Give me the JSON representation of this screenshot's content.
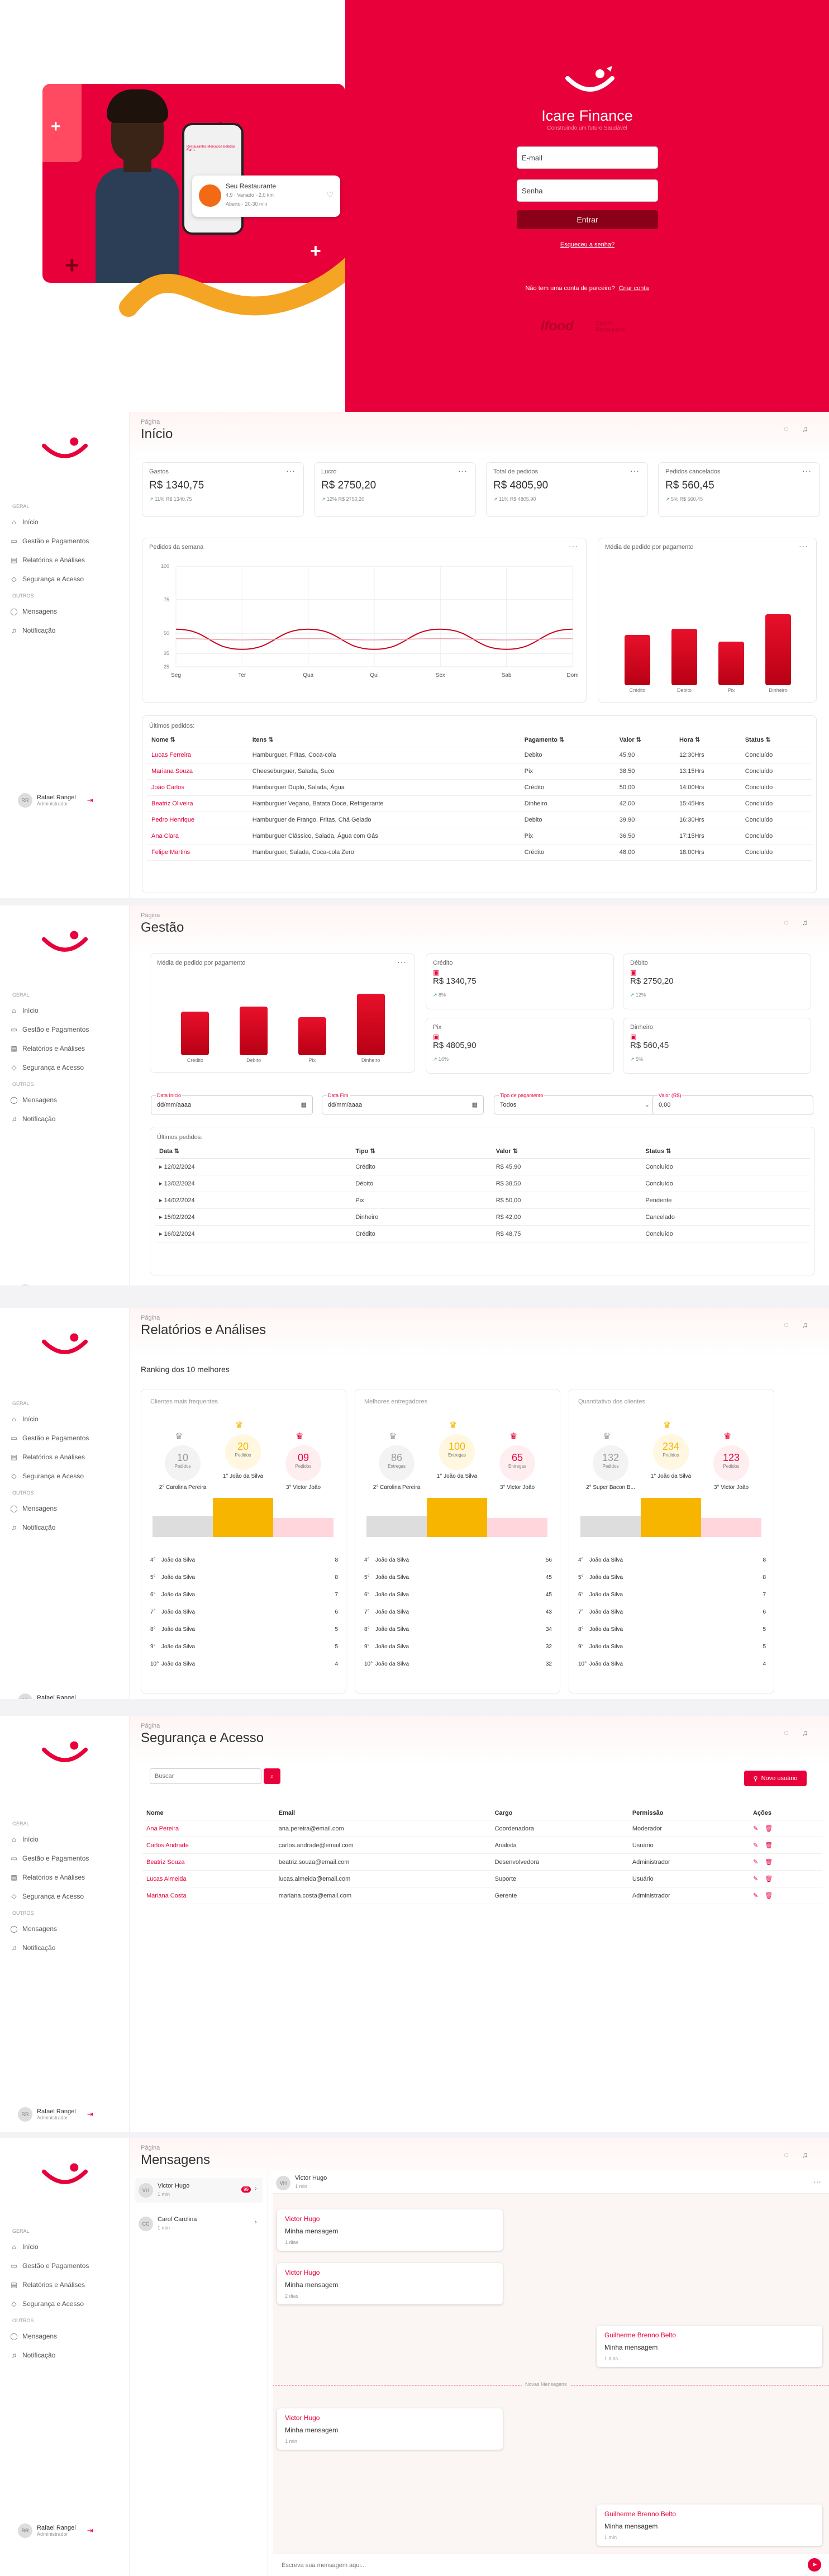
{
  "login": {
    "brand": "Icare Finance",
    "tagline": "Construindo um futuro Saudável",
    "email_placeholder": "E-mail",
    "password_placeholder": "Senha",
    "submit": "Entrar",
    "forgot": "Esqueceu a senha?",
    "partner_text": "Não tem uma conta de parceiro?",
    "partner_link": "Criar conta",
    "footer_logo": "ifood",
    "footer_logo2": "Credits Restaurante",
    "phone": {
      "name": "Seu Restaurante",
      "meta": "4,9 · Variado · 2,0 km",
      "time": "Aberto · 20-30 min",
      "tabs": "Restaurantes  Mercados  Bebidas  Farm."
    }
  },
  "sidebar": {
    "section1": "GERAL",
    "section2": "OUTROS",
    "items": [
      "Início",
      "Gestão e Pagamentos",
      "Relatórios e Análises",
      "Segurança e Acesso"
    ],
    "items2": [
      "Mensagens",
      "Notificação"
    ],
    "user_name": "Rafael Rangel",
    "user_role": "Administrador",
    "avatar": "RR"
  },
  "crumb": "Página",
  "inicio": {
    "title": "Início",
    "cards": [
      {
        "label": "Gastos",
        "value": "R$ 1340,75",
        "sub": "11%",
        "sub2": "R$ 1340,75"
      },
      {
        "label": "Lucro",
        "value": "R$ 2750,20",
        "sub": "12%",
        "sub2": "R$ 2750,20"
      },
      {
        "label": "Total de pedidos",
        "value": "R$ 4805,90",
        "sub": "11%",
        "sub2": "R$ 4805,90"
      },
      {
        "label": "Pedidos cancelados",
        "value": "R$ 560,45",
        "sub": "5%",
        "sub2": "R$ 560,45"
      }
    ],
    "line_title": "Pedidos da semana",
    "bar_title": "Média de pedido por pagamento",
    "recent_title": "Últimos pedidos:",
    "cols": [
      "Nome",
      "Itens",
      "Pagamento",
      "Valor",
      "Hora",
      "Status"
    ],
    "rows": [
      [
        "Lucas Ferreira",
        "Hamburguer, Fritas, Coca-cola",
        "Debito",
        "45,90",
        "12:30Hrs",
        "Concluído"
      ],
      [
        "Mariana Souza",
        "Cheeseburguer, Salada, Suco",
        "Pix",
        "38,50",
        "13:15Hrs",
        "Concluído"
      ],
      [
        "João Carlos",
        "Hamburguer Duplo, Salada, Água",
        "Crédito",
        "50,00",
        "14:00Hrs",
        "Concluído"
      ],
      [
        "Beatriz Oliveira",
        "Hamburguer Vegano, Batata Doce, Refrigerante",
        "Dinheiro",
        "42,00",
        "15:45Hrs",
        "Concluído"
      ],
      [
        "Pedro Henrique",
        "Hamburguer de Frango, Fritas, Chá Gelado",
        "Debito",
        "39,90",
        "16:30Hrs",
        "Concluído"
      ],
      [
        "Ana Clara",
        "Hamburguer Clássico, Salada, Água com Gás",
        "Pix",
        "36,50",
        "17:15Hrs",
        "Concluído"
      ],
      [
        "Felipe Martins",
        "Hamburguer, Salada, Coca-cola Zero",
        "Crédito",
        "48,00",
        "18:00Hrs",
        "Concluído"
      ]
    ]
  },
  "gestao": {
    "title": "Gestão",
    "bar_title": "Média de pedido por pagamento",
    "cards": [
      {
        "label": "Crédito",
        "value": "R$ 1340,75",
        "sub": "8%"
      },
      {
        "label": "Débito",
        "value": "R$ 2750,20",
        "sub": "12%"
      },
      {
        "label": "Pix",
        "value": "R$ 4805,90",
        "sub": "16%"
      },
      {
        "label": "Dinheiro",
        "value": "R$ 560,45",
        "sub": "5%"
      }
    ],
    "filters": [
      {
        "label": "Data Início",
        "value": "dd/mm/aaaa"
      },
      {
        "label": "Data Fim",
        "value": "dd/mm/aaaa"
      },
      {
        "label": "Tipo de pagamento",
        "value": "Todos"
      },
      {
        "label": "Valor (R$)",
        "value": "0,00"
      }
    ],
    "recent_title": "Últimos pedidos:",
    "cols": [
      "Data",
      "Tipo",
      "Valor",
      "Status"
    ],
    "rows": [
      [
        "12/02/2024",
        "Crédito",
        "R$ 45,90",
        "Concluído"
      ],
      [
        "13/02/2024",
        "Débito",
        "R$ 38,50",
        "Concluído"
      ],
      [
        "14/02/2024",
        "Pix",
        "R$ 50,00",
        "Pendente"
      ],
      [
        "15/02/2024",
        "Dinheiro",
        "R$ 42,00",
        "Cancelado"
      ],
      [
        "16/02/2024",
        "Crédito",
        "R$ 48,75",
        "Concluído"
      ]
    ]
  },
  "relatorios": {
    "title": "Relatórios e Análises",
    "subtitle": "Ranking dos 10 melhores",
    "panels": [
      {
        "title": "Clientes mais frequentes",
        "unit": "Pedidos",
        "top": [
          {
            "n": "10",
            "name": "2° Carolina Pereira"
          },
          {
            "n": "20",
            "name": "1° João da Silva"
          },
          {
            "n": "09",
            "name": "3° Victor João"
          }
        ],
        "list": [
          [
            "4°",
            "João da Silva",
            "8"
          ],
          [
            "5°",
            "João da Silva",
            "8"
          ],
          [
            "6°",
            "João da Silva",
            "7"
          ],
          [
            "7°",
            "João da Silva",
            "6"
          ],
          [
            "8°",
            "João da Silva",
            "5"
          ],
          [
            "9°",
            "João da Silva",
            "5"
          ],
          [
            "10°",
            "João da Silva",
            "4"
          ]
        ]
      },
      {
        "title": "Melhores entregadores",
        "unit": "Entregas",
        "top": [
          {
            "n": "86",
            "name": "2° Carolina Pereira"
          },
          {
            "n": "100",
            "name": "1° João da Silva"
          },
          {
            "n": "65",
            "name": "3° Victor João"
          }
        ],
        "list": [
          [
            "4°",
            "João da Silva",
            "56"
          ],
          [
            "5°",
            "João da Silva",
            "45"
          ],
          [
            "6°",
            "João da Silva",
            "45"
          ],
          [
            "7°",
            "João da Silva",
            "43"
          ],
          [
            "8°",
            "João da Silva",
            "34"
          ],
          [
            "9°",
            "João da Silva",
            "32"
          ],
          [
            "10°",
            "João da Silva",
            "32"
          ]
        ]
      },
      {
        "title": "Quantitativo dos clientes",
        "unit": "Pedidos",
        "top": [
          {
            "n": "132",
            "name": "2° Super Bacon B..."
          },
          {
            "n": "234",
            "name": "1° João da Silva"
          },
          {
            "n": "123",
            "name": "3° Victor João"
          }
        ],
        "list": [
          [
            "4°",
            "João da Silva",
            "8"
          ],
          [
            "5°",
            "João da Silva",
            "8"
          ],
          [
            "6°",
            "João da Silva",
            "7"
          ],
          [
            "7°",
            "João da Silva",
            "6"
          ],
          [
            "8°",
            "João da Silva",
            "5"
          ],
          [
            "9°",
            "João da Silva",
            "5"
          ],
          [
            "10°",
            "João da Silva",
            "4"
          ]
        ]
      }
    ]
  },
  "seguranca": {
    "title": "Segurança e Acesso",
    "search_placeholder": "Buscar",
    "new_user": "Novo usuário",
    "cols": [
      "Nome",
      "Email",
      "Cargo",
      "Permissão",
      "Ações"
    ],
    "rows": [
      [
        "Ana Pereira",
        "ana.pereira@email.com",
        "Coordenadora",
        "Moderador"
      ],
      [
        "Carlos Andrade",
        "carlos.andrade@email.com",
        "Analista",
        "Usuário"
      ],
      [
        "Beatriz Souza",
        "beatriz.souza@email.com",
        "Desenvolvedora",
        "Administrador"
      ],
      [
        "Lucas Almeida",
        "lucas.almeida@email.com",
        "Suporte",
        "Usuário"
      ],
      [
        "Mariana Costa",
        "mariana.costa@email.com",
        "Gerente",
        "Administrador"
      ]
    ]
  },
  "mensagens": {
    "title": "Mensagens",
    "contacts": [
      {
        "name": "Victor Hugo",
        "time": "1 min",
        "badge": "99",
        "avatar": "VH"
      },
      {
        "name": "Carol Carolina",
        "time": "1 min",
        "avatar": "CC"
      }
    ],
    "chat_name": "Victor Hugo",
    "chat_time": "1 min",
    "chat_avatar": "VH",
    "messages": [
      {
        "author": "Victor Hugo",
        "text": "Minha mensagem",
        "time": "1 dias"
      },
      {
        "author": "Victor Hugo",
        "text": "Minha mensagem",
        "time": "2 dias"
      },
      {
        "author": "Guilherme Brenno Belto",
        "text": "Minha mensagem",
        "time": "1 dias"
      },
      {
        "author": "Victor Hugo",
        "text": "Minha mensagem",
        "time": "1 min"
      },
      {
        "author": "Guilherme Brenno Belto",
        "text": "Minha mensagem",
        "time": "1 min"
      }
    ],
    "divider": "Novas Mensagens",
    "input_placeholder": "Escreva sua mensagem aqui..."
  },
  "chart_data": [
    {
      "type": "line",
      "title": "Pedidos da semana",
      "categories": [
        "Seg",
        "Ter",
        "Qua",
        "Qui",
        "Sex",
        "Sab",
        "Dom"
      ],
      "ylim": [
        25,
        100
      ],
      "yticks": [
        100,
        75,
        50,
        35,
        25
      ],
      "series": [
        {
          "values": [
            53,
            38,
            53,
            38,
            53,
            38,
            53
          ]
        },
        {
          "values": [
            46,
            45,
            46,
            45,
            46,
            45,
            46
          ]
        }
      ]
    },
    {
      "type": "bar",
      "title": "Média de pedido por pagamento",
      "categories": [
        "Crédito",
        "Debito",
        "Pix",
        "Dinheiro"
      ],
      "values": [
        55,
        62,
        48,
        78
      ]
    }
  ],
  "colors": {
    "brand": "#e8003a",
    "dark": "#8b0019"
  }
}
